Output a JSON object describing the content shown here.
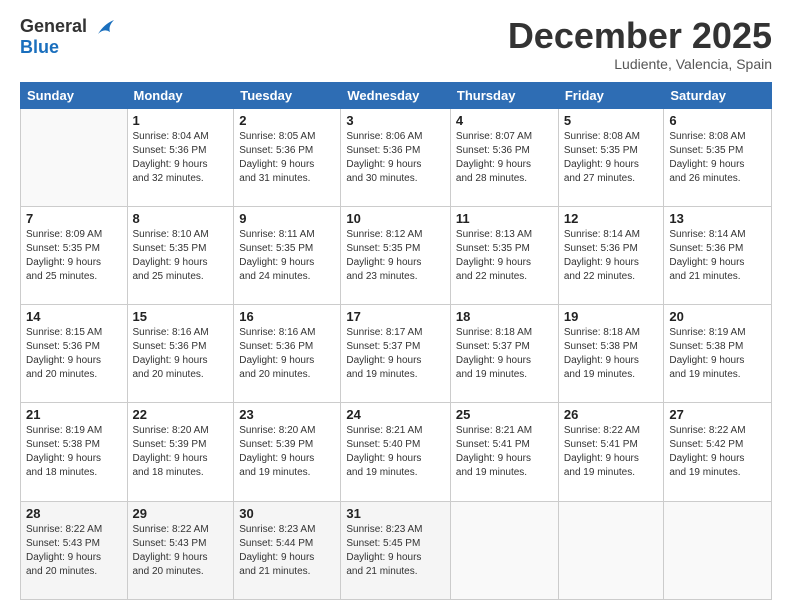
{
  "header": {
    "logo_line1": "General",
    "logo_line2": "Blue",
    "month": "December 2025",
    "location": "Ludiente, Valencia, Spain"
  },
  "weekdays": [
    "Sunday",
    "Monday",
    "Tuesday",
    "Wednesday",
    "Thursday",
    "Friday",
    "Saturday"
  ],
  "weeks": [
    [
      {
        "num": "",
        "info": ""
      },
      {
        "num": "1",
        "info": "Sunrise: 8:04 AM\nSunset: 5:36 PM\nDaylight: 9 hours\nand 32 minutes."
      },
      {
        "num": "2",
        "info": "Sunrise: 8:05 AM\nSunset: 5:36 PM\nDaylight: 9 hours\nand 31 minutes."
      },
      {
        "num": "3",
        "info": "Sunrise: 8:06 AM\nSunset: 5:36 PM\nDaylight: 9 hours\nand 30 minutes."
      },
      {
        "num": "4",
        "info": "Sunrise: 8:07 AM\nSunset: 5:36 PM\nDaylight: 9 hours\nand 28 minutes."
      },
      {
        "num": "5",
        "info": "Sunrise: 8:08 AM\nSunset: 5:35 PM\nDaylight: 9 hours\nand 27 minutes."
      },
      {
        "num": "6",
        "info": "Sunrise: 8:08 AM\nSunset: 5:35 PM\nDaylight: 9 hours\nand 26 minutes."
      }
    ],
    [
      {
        "num": "7",
        "info": "Sunrise: 8:09 AM\nSunset: 5:35 PM\nDaylight: 9 hours\nand 25 minutes."
      },
      {
        "num": "8",
        "info": "Sunrise: 8:10 AM\nSunset: 5:35 PM\nDaylight: 9 hours\nand 25 minutes."
      },
      {
        "num": "9",
        "info": "Sunrise: 8:11 AM\nSunset: 5:35 PM\nDaylight: 9 hours\nand 24 minutes."
      },
      {
        "num": "10",
        "info": "Sunrise: 8:12 AM\nSunset: 5:35 PM\nDaylight: 9 hours\nand 23 minutes."
      },
      {
        "num": "11",
        "info": "Sunrise: 8:13 AM\nSunset: 5:35 PM\nDaylight: 9 hours\nand 22 minutes."
      },
      {
        "num": "12",
        "info": "Sunrise: 8:14 AM\nSunset: 5:36 PM\nDaylight: 9 hours\nand 22 minutes."
      },
      {
        "num": "13",
        "info": "Sunrise: 8:14 AM\nSunset: 5:36 PM\nDaylight: 9 hours\nand 21 minutes."
      }
    ],
    [
      {
        "num": "14",
        "info": "Sunrise: 8:15 AM\nSunset: 5:36 PM\nDaylight: 9 hours\nand 20 minutes."
      },
      {
        "num": "15",
        "info": "Sunrise: 8:16 AM\nSunset: 5:36 PM\nDaylight: 9 hours\nand 20 minutes."
      },
      {
        "num": "16",
        "info": "Sunrise: 8:16 AM\nSunset: 5:36 PM\nDaylight: 9 hours\nand 20 minutes."
      },
      {
        "num": "17",
        "info": "Sunrise: 8:17 AM\nSunset: 5:37 PM\nDaylight: 9 hours\nand 19 minutes."
      },
      {
        "num": "18",
        "info": "Sunrise: 8:18 AM\nSunset: 5:37 PM\nDaylight: 9 hours\nand 19 minutes."
      },
      {
        "num": "19",
        "info": "Sunrise: 8:18 AM\nSunset: 5:38 PM\nDaylight: 9 hours\nand 19 minutes."
      },
      {
        "num": "20",
        "info": "Sunrise: 8:19 AM\nSunset: 5:38 PM\nDaylight: 9 hours\nand 19 minutes."
      }
    ],
    [
      {
        "num": "21",
        "info": "Sunrise: 8:19 AM\nSunset: 5:38 PM\nDaylight: 9 hours\nand 18 minutes."
      },
      {
        "num": "22",
        "info": "Sunrise: 8:20 AM\nSunset: 5:39 PM\nDaylight: 9 hours\nand 18 minutes."
      },
      {
        "num": "23",
        "info": "Sunrise: 8:20 AM\nSunset: 5:39 PM\nDaylight: 9 hours\nand 19 minutes."
      },
      {
        "num": "24",
        "info": "Sunrise: 8:21 AM\nSunset: 5:40 PM\nDaylight: 9 hours\nand 19 minutes."
      },
      {
        "num": "25",
        "info": "Sunrise: 8:21 AM\nSunset: 5:41 PM\nDaylight: 9 hours\nand 19 minutes."
      },
      {
        "num": "26",
        "info": "Sunrise: 8:22 AM\nSunset: 5:41 PM\nDaylight: 9 hours\nand 19 minutes."
      },
      {
        "num": "27",
        "info": "Sunrise: 8:22 AM\nSunset: 5:42 PM\nDaylight: 9 hours\nand 19 minutes."
      }
    ],
    [
      {
        "num": "28",
        "info": "Sunrise: 8:22 AM\nSunset: 5:43 PM\nDaylight: 9 hours\nand 20 minutes."
      },
      {
        "num": "29",
        "info": "Sunrise: 8:22 AM\nSunset: 5:43 PM\nDaylight: 9 hours\nand 20 minutes."
      },
      {
        "num": "30",
        "info": "Sunrise: 8:23 AM\nSunset: 5:44 PM\nDaylight: 9 hours\nand 21 minutes."
      },
      {
        "num": "31",
        "info": "Sunrise: 8:23 AM\nSunset: 5:45 PM\nDaylight: 9 hours\nand 21 minutes."
      },
      {
        "num": "",
        "info": ""
      },
      {
        "num": "",
        "info": ""
      },
      {
        "num": "",
        "info": ""
      }
    ]
  ]
}
